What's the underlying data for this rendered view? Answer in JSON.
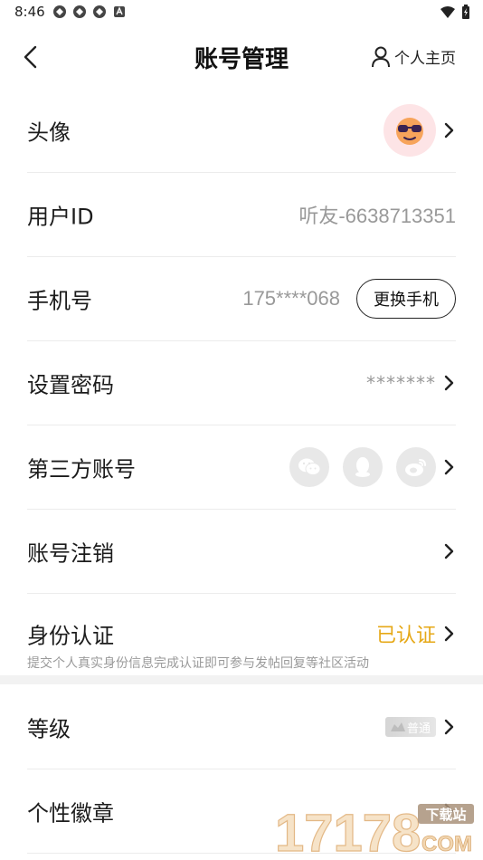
{
  "status_bar": {
    "time": "8:46"
  },
  "header": {
    "back_icon": "chevron-left-icon",
    "title": "账号管理",
    "profile_link": "个人主页",
    "profile_icon": "person-icon"
  },
  "rows": {
    "avatar": {
      "label": "头像"
    },
    "user_id": {
      "label": "用户ID",
      "value": "听友-6638713351"
    },
    "phone": {
      "label": "手机号",
      "value": "175****068",
      "button": "更换手机"
    },
    "password": {
      "label": "设置密码",
      "value": "*******"
    },
    "third_party": {
      "label": "第三方账号",
      "icons": [
        "wechat-icon",
        "qq-icon",
        "weibo-icon"
      ]
    },
    "cancel": {
      "label": "账号注销"
    },
    "identity": {
      "label": "身份认证",
      "status": "已认证",
      "hint": "提交个人真实身份信息完成认证即可参与发帖回复等社区活动"
    },
    "level": {
      "label": "等级",
      "badge": "普通"
    },
    "badge": {
      "label": "个性徽章"
    }
  },
  "watermark": {
    "text": "17178",
    "tag": "下载站",
    "domain": "COM"
  },
  "colors": {
    "accent": "#e6a817",
    "muted": "#999999",
    "divider": "#ececec"
  }
}
